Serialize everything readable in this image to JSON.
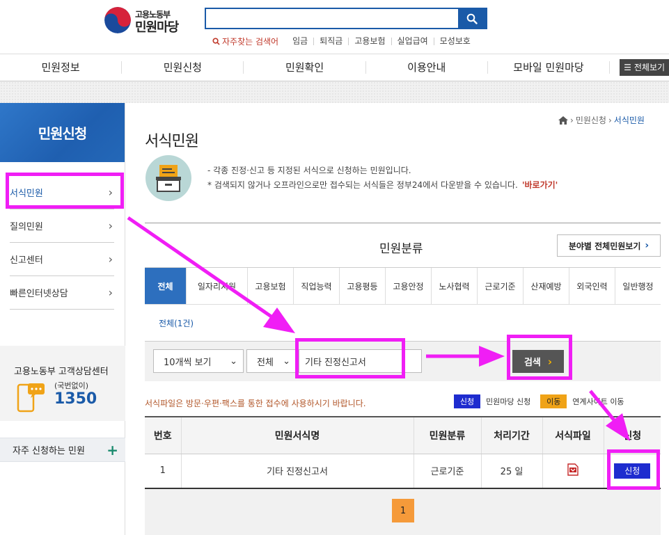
{
  "header": {
    "logo_top": "고용노동부",
    "logo_bottom": "민원마당",
    "search_value": "",
    "keywords_label": "자주찾는 검색어",
    "keywords": [
      "임금",
      "퇴직금",
      "고용보험",
      "실업급여",
      "모성보호"
    ]
  },
  "gnb": {
    "items": [
      "민원정보",
      "민원신청",
      "민원확인",
      "이용안내",
      "모바일 민원마당"
    ],
    "all_label": "전체보기"
  },
  "sidebar": {
    "title": "민원신청",
    "items": [
      {
        "label": "서식민원"
      },
      {
        "label": "질의민원"
      },
      {
        "label": "신고센터"
      },
      {
        "label": "빠른인터넷상담"
      }
    ],
    "center_title": "고용노동부 고객상담센터",
    "center_sub": "(국번없이)",
    "center_number": "1350",
    "frequent_label": "자주 신청하는 민원"
  },
  "breadcrumb": {
    "items": [
      "민원신청",
      "서식민원"
    ]
  },
  "page": {
    "title": "서식민원",
    "desc_line1": "- 각종 진정·신고 등 지정된 서식으로 신청하는 민원입니다.",
    "desc_line2": "* 검색되지 않거나 오프라인으로만 접수되는 서식들은 정부24에서 다운받을 수 있습니다.",
    "desc_link": "'바로가기'"
  },
  "category": {
    "title": "민원분류",
    "all_button": "분야별 전체민원보기",
    "tabs": [
      "전체",
      "일자리지원",
      "고용보험",
      "직업능력",
      "고용평등",
      "고용안정",
      "노사협력",
      "근로기준",
      "산재예방",
      "외국인력",
      "일반행정"
    ],
    "count_text": "전체(1건)"
  },
  "filter": {
    "page_size": "10개씩 보기",
    "scope": "전체",
    "keyword": "기타 진정신고서",
    "search_label": "검색"
  },
  "notice": "서식파일은 방문·우편·팩스를 통한 접수에 사용하시기 바랍니다.",
  "legend": {
    "apply_badge": "신청",
    "apply_text": "민원마당 신청",
    "move_badge": "이동",
    "move_text": "연계사이트 이동"
  },
  "table": {
    "headers": [
      "번호",
      "민원서식명",
      "민원분류",
      "처리기간",
      "서식파일",
      "신청"
    ],
    "rows": [
      {
        "no": "1",
        "name": "기타 진정신고서",
        "category": "근로기준",
        "period": "25 일",
        "apply": "신청"
      }
    ]
  },
  "pagination": {
    "current": "1"
  },
  "colors": {
    "brand": "#1a5aa8",
    "highlight": "#f01ef5",
    "apply": "#1e2ccf",
    "move": "#f0a317"
  }
}
